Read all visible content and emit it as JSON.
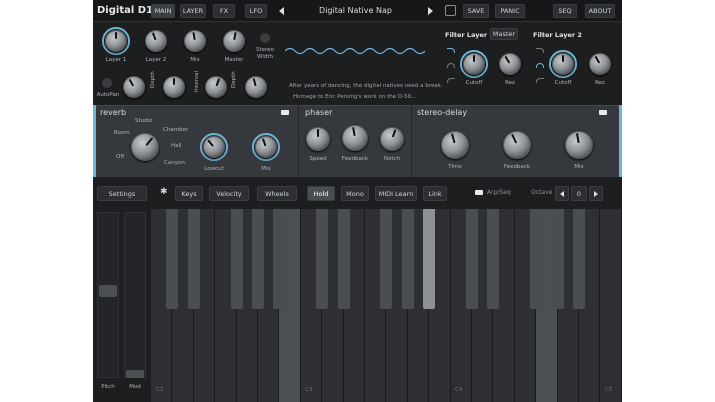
{
  "topbar": {
    "logo": "Digital D1",
    "tabs": [
      "MAIN",
      "LAYER",
      "FX",
      "LFO"
    ],
    "patch_name": "Digital Native Nap",
    "save": "SAVE",
    "panic": "PANIC",
    "seq": "SEQ",
    "about": "ABOUT"
  },
  "mixer": {
    "knobs": [
      "Layer 1",
      "Layer 2",
      "Mix",
      "Master"
    ],
    "stereo_label": "Stereo\nWidth",
    "autopan": "AutoPan",
    "depth1": "Depth",
    "interval": "Interval",
    "depth2": "Depth"
  },
  "description": {
    "line1": "After years of dancing, the digital natives need a break.",
    "line2": "Homage to Eric Persing's work on the D-50..."
  },
  "filters": {
    "layer1": "Filter Layer 1",
    "master": "Master",
    "layer2": "Filter Layer 2",
    "cutoff": "Cutoff",
    "rez": "Rez"
  },
  "fx": {
    "reverb": {
      "title": "reverb",
      "types": [
        "Studio",
        "Room",
        "Chamber",
        "Hall",
        "Off",
        "Canyon"
      ],
      "lowcut": "Lowcut",
      "mix": "Mix"
    },
    "phaser": {
      "title": "phaser",
      "speed": "Speed",
      "feedback": "Feedback",
      "notch": "Notch"
    },
    "delay": {
      "title": "stereo-delay",
      "time": "Time",
      "feedback": "Feedback",
      "mix": "Mix"
    }
  },
  "controls": {
    "settings": "Settings",
    "keys": "Keys",
    "velocity": "Velocity",
    "wheels": "Wheels",
    "hold": "Hold",
    "mono": "Mono",
    "midi_learn": "MIDI Learn",
    "link": "Link",
    "arp": "Arp/Seq",
    "octave": "Octave",
    "octave_value": "0"
  },
  "wheels": {
    "pitch": "Pitch",
    "mod": "Mod"
  },
  "notes": [
    "C2",
    "C3",
    "C4",
    "C5"
  ],
  "colors": {
    "accent": "#6fb6d6",
    "bg": "#1d1e20"
  }
}
